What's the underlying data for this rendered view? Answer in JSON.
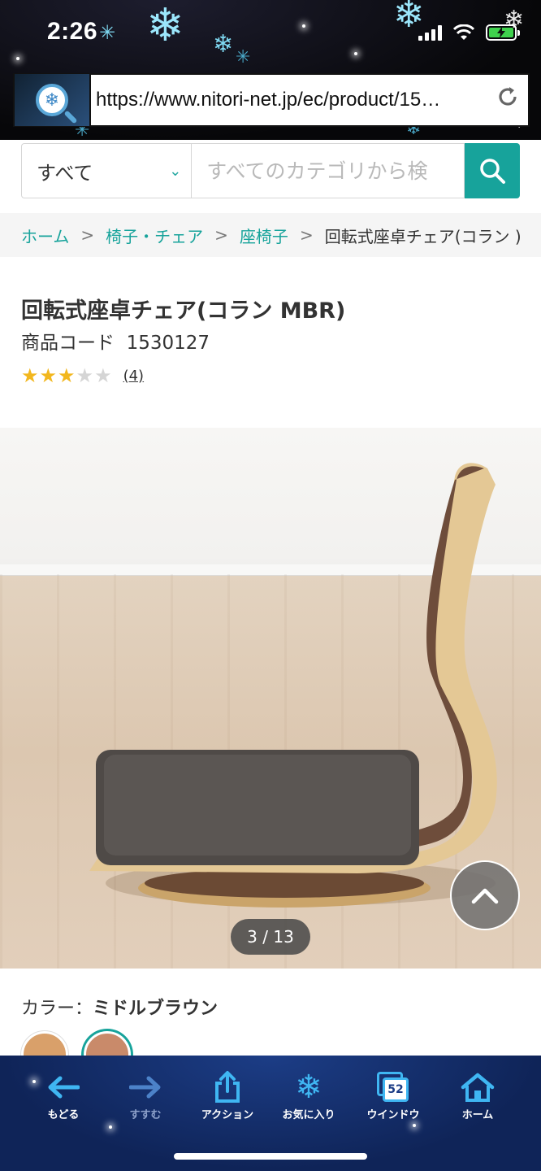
{
  "status_bar": {
    "time": "2:26"
  },
  "browser": {
    "url": "https://www.nitori-net.jp/ec/product/15…"
  },
  "search": {
    "category_selected": "すべて",
    "placeholder": "すべてのカテゴリから検"
  },
  "breadcrumb": {
    "items": [
      "ホーム",
      "椅子・チェア",
      "座椅子"
    ],
    "current": "回転式座卓チェア(コラン )"
  },
  "product": {
    "title": "回転式座卓チェア(コラン MBR)",
    "code_label": "商品コード",
    "code": "1530127",
    "rating": 3,
    "rating_max": 5,
    "review_count": "(4)"
  },
  "gallery": {
    "counter": "3 / 13"
  },
  "color": {
    "label": "カラー：",
    "value": "ミドルブラウン"
  },
  "toolbar": {
    "back": "もどる",
    "forward": "すすむ",
    "action": "アクション",
    "favorites": "お気に入り",
    "windows": "ウインドウ",
    "windows_count": "52",
    "home": "ホーム"
  },
  "colors": {
    "accent": "#17a39b",
    "toolbar_bg": "#0f2458",
    "star": "#f2b71e"
  }
}
